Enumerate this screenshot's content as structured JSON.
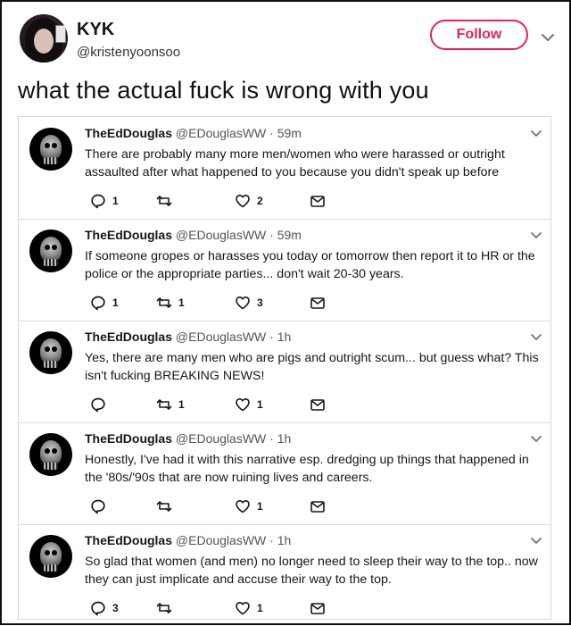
{
  "tweet": {
    "author_name": "KYK",
    "author_handle": "@kristenyoonsoo",
    "follow_label": "Follow",
    "text": "what the actual fuck is wrong with you"
  },
  "replies": [
    {
      "name": "TheEdDouglas",
      "handle": "@EDouglasWW",
      "time": "· 59m",
      "text": "There are probably many more men/women who were harassed or outright assaulted after what happened to you because you didn't speak up before",
      "reply_count": "1",
      "retweet_count": "",
      "like_count": "2"
    },
    {
      "name": "TheEdDouglas",
      "handle": "@EDouglasWW",
      "time": "· 59m",
      "text": "If someone gropes or harasses you today or tomorrow then report it to HR or the police or the appropriate parties... don't wait 20-30 years.",
      "reply_count": "1",
      "retweet_count": "1",
      "like_count": "3"
    },
    {
      "name": "TheEdDouglas",
      "handle": "@EDouglasWW",
      "time": "· 1h",
      "text": "Yes, there are many men who are pigs and outright scum... but guess what? This isn't fucking BREAKING NEWS!",
      "reply_count": "",
      "retweet_count": "1",
      "like_count": "1"
    },
    {
      "name": "TheEdDouglas",
      "handle": "@EDouglasWW",
      "time": "· 1h",
      "text": "Honestly, I've had it with this narrative esp. dredging up things that happened in the '80s/'90s that are now ruining lives and careers.",
      "reply_count": "",
      "retweet_count": "",
      "like_count": "1"
    },
    {
      "name": "TheEdDouglas",
      "handle": "@EDouglasWW",
      "time": "· 1h",
      "text": "So glad that women (and men) no longer need to sleep their way to the top.. now they can just implicate and accuse their way to the top.",
      "reply_count": "3",
      "retweet_count": "",
      "like_count": "1"
    }
  ],
  "colors": {
    "follow_accent": "#e0245e",
    "icon_gray": "#657786"
  },
  "icons": [
    "chevron-down-icon",
    "reply-icon",
    "retweet-icon",
    "heart-icon",
    "envelope-icon"
  ]
}
